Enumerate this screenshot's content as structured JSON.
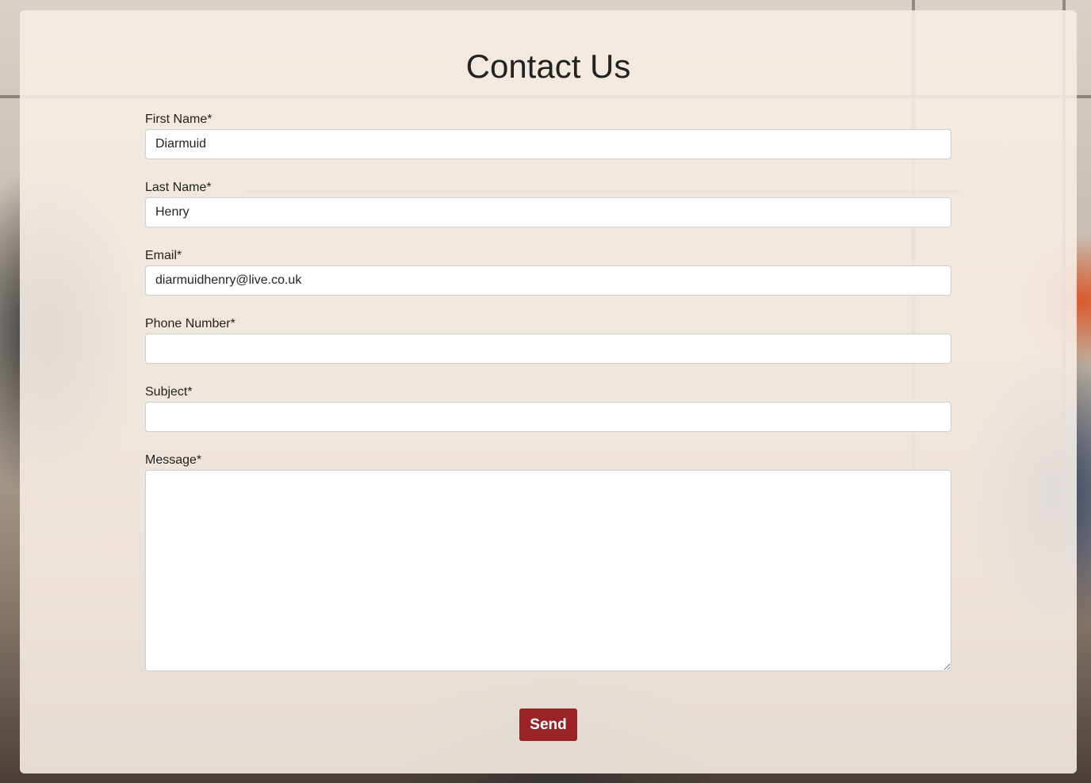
{
  "page": {
    "title": "Contact Us"
  },
  "form": {
    "first_name": {
      "label": "First Name*",
      "value": "Diarmuid"
    },
    "last_name": {
      "label": "Last Name*",
      "value": "Henry"
    },
    "email": {
      "label": "Email*",
      "value": "diarmuidhenry@live.co.uk"
    },
    "phone": {
      "label": "Phone Number*",
      "value": ""
    },
    "subject": {
      "label": "Subject*",
      "value": ""
    },
    "message": {
      "label": "Message*",
      "value": ""
    },
    "submit_label": "Send"
  },
  "colors": {
    "button": "#9b2226",
    "card": "#f5ece4"
  }
}
